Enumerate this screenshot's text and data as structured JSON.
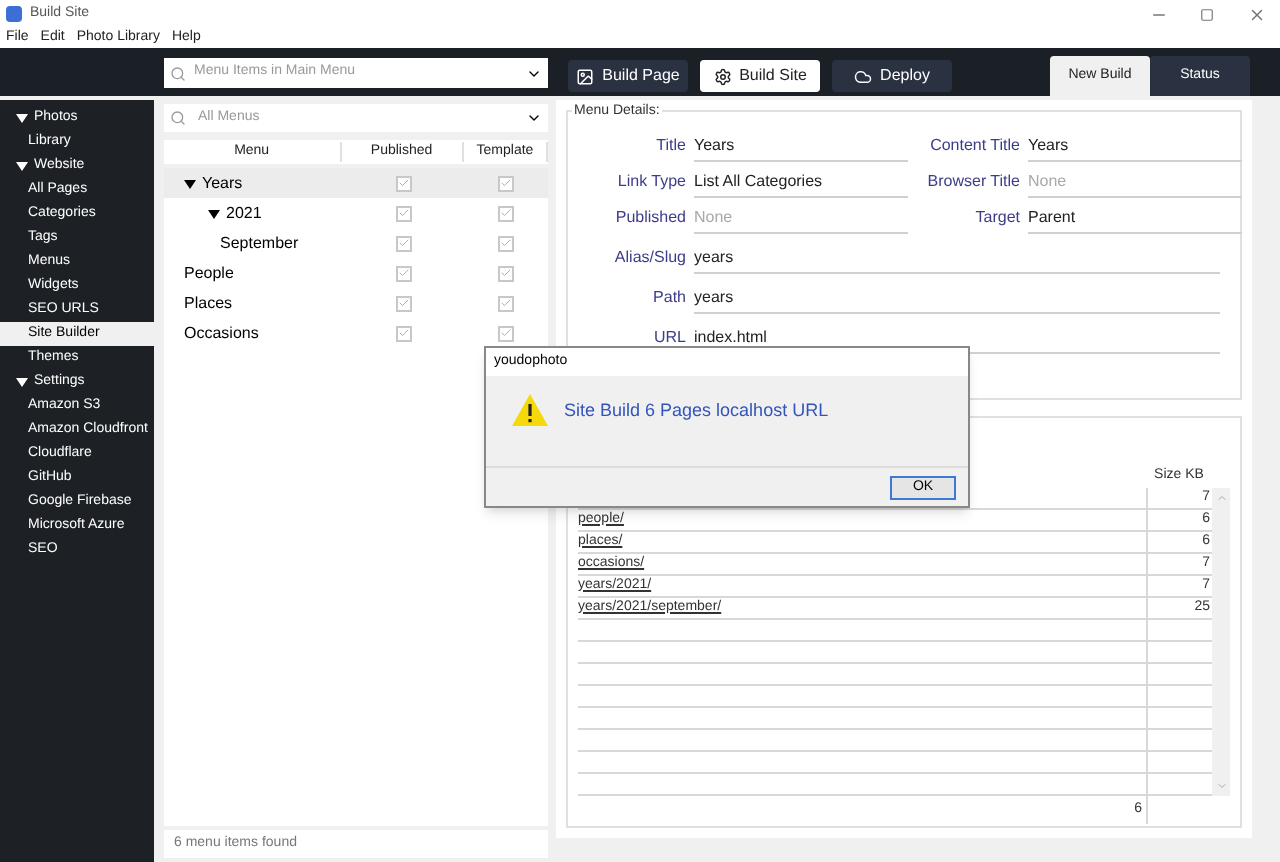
{
  "window": {
    "title": "Build Site"
  },
  "menu_bar": [
    "File",
    "Edit",
    "Photo Library",
    "Help"
  ],
  "toolbar": {
    "menu_search": {
      "placeholder": "Menu Items in Main Menu"
    },
    "buttons": [
      {
        "label": "Build Page",
        "kind": "image",
        "selected": false
      },
      {
        "label": "Build Site",
        "kind": "gear",
        "selected": true
      },
      {
        "label": "Deploy",
        "kind": "cloud",
        "selected": false
      }
    ],
    "tabs": [
      {
        "label": "New Build",
        "selected": true
      },
      {
        "label": "Status",
        "selected": false
      }
    ]
  },
  "sidebar": {
    "items": [
      {
        "label": "Photos",
        "expanded": true,
        "selected": false,
        "children": [
          {
            "label": "Library",
            "selected": false
          }
        ]
      },
      {
        "label": "Website",
        "expanded": true,
        "selected": false,
        "children": [
          {
            "label": "All Pages",
            "selected": false
          },
          {
            "label": "Categories",
            "selected": false
          },
          {
            "label": "Tags",
            "selected": false
          },
          {
            "label": "Menus",
            "selected": false
          },
          {
            "label": "Widgets",
            "selected": false
          },
          {
            "label": "SEO URLS",
            "selected": false
          },
          {
            "label": "Site Builder",
            "selected": true
          },
          {
            "label": "Themes",
            "selected": false
          }
        ]
      },
      {
        "label": "Settings",
        "expanded": true,
        "selected": false,
        "children": [
          {
            "label": "Amazon S3",
            "selected": false
          },
          {
            "label": "Amazon Cloudfront",
            "selected": false
          },
          {
            "label": "Cloudflare",
            "selected": false
          },
          {
            "label": "GitHub",
            "selected": false
          },
          {
            "label": "Google Firebase",
            "selected": false
          },
          {
            "label": "Microsoft Azure",
            "selected": false
          },
          {
            "label": "SEO",
            "selected": false
          }
        ]
      }
    ]
  },
  "menus": {
    "search": {
      "placeholder": "All Menus"
    },
    "columns": [
      "Menu",
      "Published",
      "Template"
    ],
    "rows": [
      {
        "name": "Years",
        "expanded": true,
        "selected": true,
        "published": true,
        "template": true,
        "children": [
          {
            "name": "2021",
            "expanded": true,
            "selected": false,
            "published": true,
            "template": true,
            "children": [
              {
                "name": "September",
                "selected": false,
                "published": true,
                "template": true
              }
            ]
          }
        ]
      },
      {
        "name": "People",
        "selected": false,
        "published": true,
        "template": true
      },
      {
        "name": "Places",
        "selected": false,
        "published": true,
        "template": true
      },
      {
        "name": "Occasions",
        "selected": false,
        "published": true,
        "template": true
      }
    ],
    "status": "6 menu items found"
  },
  "menu_details": {
    "legend": "Menu Details:",
    "pairs": [
      [
        {
          "label": "Title",
          "value": "Years",
          "empty": false
        },
        {
          "label": "Content Title",
          "value": "Years",
          "empty": false
        }
      ],
      [
        {
          "label": "Link Type",
          "value": "List All Categories",
          "empty": false
        },
        {
          "label": "Browser Title",
          "placeholder": "None"
        }
      ],
      [
        {
          "label": "Published",
          "placeholder": "None"
        },
        {
          "label": "Target",
          "value": "Parent",
          "empty": false
        }
      ]
    ],
    "fields": [
      {
        "label": "Alias/Slug",
        "value": "years"
      },
      {
        "label": "Path",
        "value": "years"
      },
      {
        "label": "URL",
        "value": "index.html"
      }
    ]
  },
  "build_results": {
    "columns": [
      "Size KB"
    ],
    "rows": [
      {
        "size": "7"
      },
      {
        "path": "people/",
        "size": "6"
      },
      {
        "path": "places/",
        "size": "6"
      },
      {
        "path": "occasions/",
        "size": "7"
      },
      {
        "path": "years/2021/",
        "size": "7"
      },
      {
        "path": "years/2021/september/",
        "size": "25"
      }
    ],
    "total": "6"
  },
  "dialog": {
    "title": "youdophoto",
    "message": "Site Build 6 Pages localhost URL",
    "button": "OK"
  }
}
